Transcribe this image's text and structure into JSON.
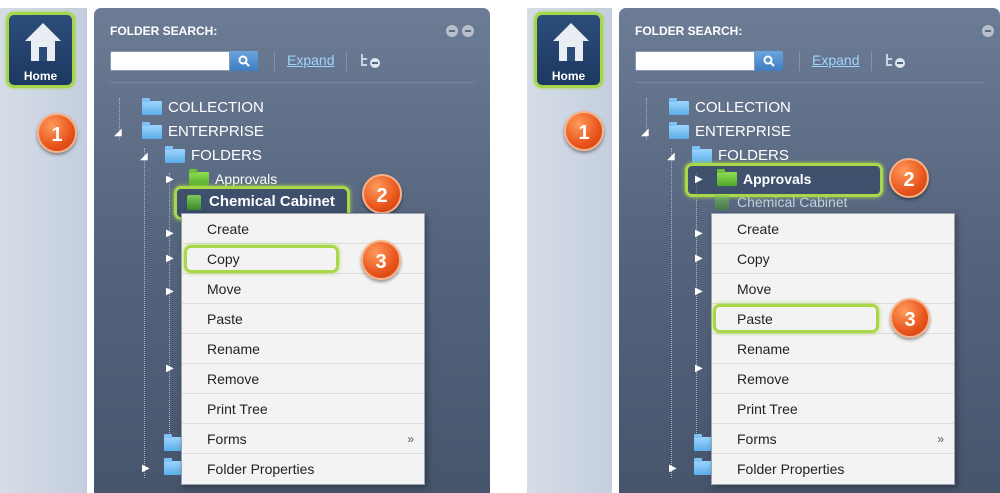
{
  "home_label": "Home",
  "panel_title": "FOLDER SEARCH:",
  "expand_label": "Expand",
  "tree": {
    "collection": "COLLECTION",
    "enterprise": "ENTERPRISE",
    "folders": "FOLDERS",
    "approvals": "Approvals",
    "chemical_cabinet": "Chemical Cabinet"
  },
  "menu_items": {
    "create": "Create",
    "copy": "Copy",
    "move": "Move",
    "paste": "Paste",
    "rename": "Rename",
    "remove": "Remove",
    "print_tree": "Print Tree",
    "forms": "Forms",
    "folder_properties": "Folder Properties"
  },
  "submenu_arrow": "»",
  "badges": {
    "one": "1",
    "two": "2",
    "three": "3"
  },
  "colors": {
    "highlight": "#a8d84a",
    "badge": "#e8541c",
    "panel": "#57667f",
    "folder": "#5aaee8"
  },
  "icons": [
    "home-icon",
    "search-icon",
    "tree-view-icon",
    "folder-icon",
    "green-folder-icon",
    "cabinet-icon",
    "minimize-icon",
    "close-icon"
  ]
}
